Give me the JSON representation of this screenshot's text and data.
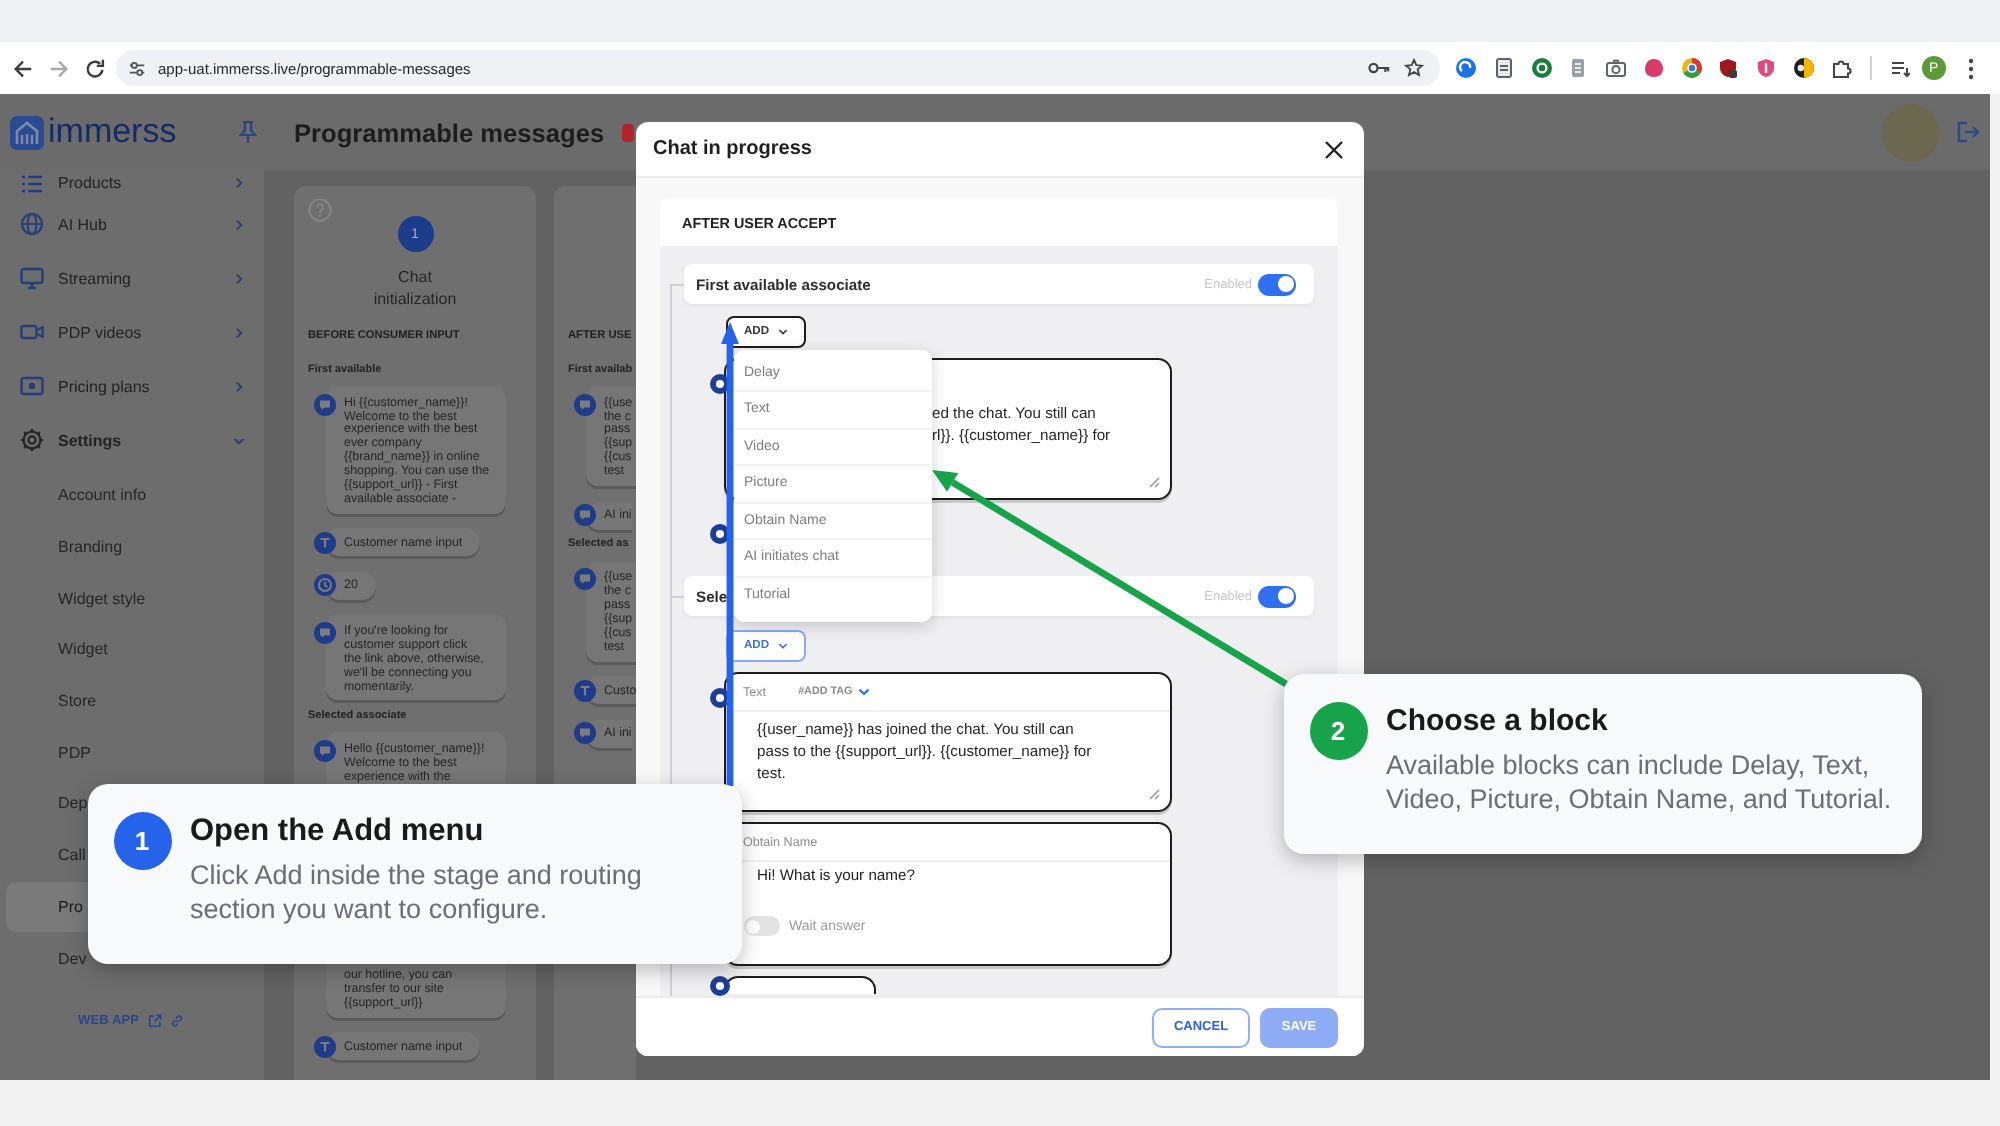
{
  "browser": {
    "url": "app-uat.immerss.live/programmable-messages",
    "profile": "P"
  },
  "header": {
    "logo": "immerss",
    "title": "Programmable messages"
  },
  "sidebar": {
    "items": [
      {
        "label": "Products",
        "expanded": false
      },
      {
        "label": "AI Hub",
        "expanded": false
      },
      {
        "label": "Streaming",
        "expanded": false
      },
      {
        "label": "PDP videos",
        "expanded": false
      },
      {
        "label": "Pricing plans",
        "expanded": false
      },
      {
        "label": "Settings",
        "expanded": true,
        "children": [
          {
            "label": "Account info",
            "selected": false
          },
          {
            "label": "Branding",
            "selected": false
          },
          {
            "label": "Widget style",
            "selected": false
          },
          {
            "label": "Widget",
            "selected": false
          },
          {
            "label": "Store",
            "selected": false
          },
          {
            "label": "PDP",
            "selected": false
          },
          {
            "label": "Dep",
            "selected": false
          },
          {
            "label": "Call",
            "selected": false
          },
          {
            "label": "Pro",
            "selected": true
          },
          {
            "label": "Dev",
            "selected": false
          }
        ]
      }
    ],
    "link": "WEB APP"
  },
  "stages": [
    {
      "step": "1",
      "title": "Chat initialization",
      "sections": [
        {
          "heading": "BEFORE CONSUMER INPUT",
          "groups": [
            {
              "label": "First available",
              "blocks": [
                {
                  "kind": "message",
                  "lines": [
                    "Hi {{customer_name}}!",
                    "Welcome to the best",
                    "experience with the best",
                    "ever company",
                    "{{brand_name}} in online",
                    "shopping. You can use the",
                    "{{support_url}} - First",
                    "available associate -"
                  ]
                },
                {
                  "kind": "input",
                  "text": "Customer name input"
                },
                {
                  "kind": "delay",
                  "text": "20"
                },
                {
                  "kind": "message",
                  "lines": [
                    "If you're looking for",
                    "customer support click",
                    "the link above, otherwise,",
                    "we'll be connecting you",
                    "momentarily."
                  ]
                }
              ]
            },
            {
              "label": "Selected associate",
              "blocks": [
                {
                  "kind": "message",
                  "lines": [
                    "Hello {{customer_name}}!",
                    "Welcome to the best",
                    "experience with the"
                  ],
                  "lines_after": [
                    "our hotline, you can",
                    "transfer to our site",
                    "{{support_url}}"
                  ]
                },
                {
                  "kind": "input",
                  "text": "Customer name input"
                }
              ]
            }
          ]
        }
      ]
    },
    {
      "sections": [
        {
          "heading": "AFTER USE",
          "groups": [
            {
              "label": "First availab",
              "blocks": [
                {
                  "kind": "message",
                  "lines": [
                    "{{use",
                    "the c",
                    "pass",
                    "{{sup",
                    "{{cus",
                    "test"
                  ]
                },
                {
                  "kind": "ai",
                  "text": "AI ini"
                }
              ]
            },
            {
              "label": "Selected as",
              "blocks": [
                {
                  "kind": "message",
                  "lines": [
                    "{{use",
                    "the c",
                    "pass",
                    "{{sup",
                    "{{cus",
                    "test"
                  ]
                },
                {
                  "kind": "input",
                  "text": "Custo"
                },
                {
                  "kind": "ai",
                  "text": "AI ini"
                }
              ]
            }
          ]
        }
      ]
    }
  ],
  "modal": {
    "title": "Chat in progress",
    "section": "AFTER USER ACCEPT",
    "routes": [
      {
        "label": "First available associate",
        "status": "Enabled",
        "enabled": true,
        "add": {
          "label": "ADD",
          "open": true,
          "items": [
            "Delay",
            "Text",
            "Video",
            "Picture",
            "Obtain Name",
            "AI initiates chat",
            "Tutorial"
          ]
        },
        "blocks": [
          {
            "kind": "text",
            "lines": [
              "ed the chat. You still can",
              "rl}}. {{customer_name}} for"
            ]
          },
          {
            "kind": "marker"
          }
        ]
      },
      {
        "label": "Sele",
        "status": "Enabled",
        "enabled": true,
        "add": {
          "label": "ADD",
          "open": false
        },
        "blocks": [
          {
            "kind": "text",
            "label": "Text",
            "tag": "#ADD TAG",
            "lines": [
              "{{user_name}} has joined the chat. You still can",
              "pass to the {{support_url}}. {{customer_name}} for",
              "test."
            ]
          },
          {
            "kind": "obtain_name",
            "label": "Obtain Name",
            "text": "Hi! What is your name?",
            "wait_label": "Wait answer",
            "wait": false
          },
          {
            "kind": "partial"
          }
        ]
      }
    ],
    "buttons": [
      {
        "label": "CANCEL",
        "kind": "secondary",
        "disabled": false
      },
      {
        "label": "SAVE",
        "kind": "primary",
        "disabled": true
      }
    ]
  },
  "tutorial": {
    "steps": [
      {
        "number": "1",
        "title": "Open the Add menu",
        "text": "Click Add inside the stage and routing section you want to configure.",
        "color": "#2563eb"
      },
      {
        "number": "2",
        "title": "Choose a block",
        "text": "Available blocks can include Delay, Text, Video, Picture, Obtain Name, and Tutorial.",
        "color": "#16a34a"
      }
    ]
  }
}
